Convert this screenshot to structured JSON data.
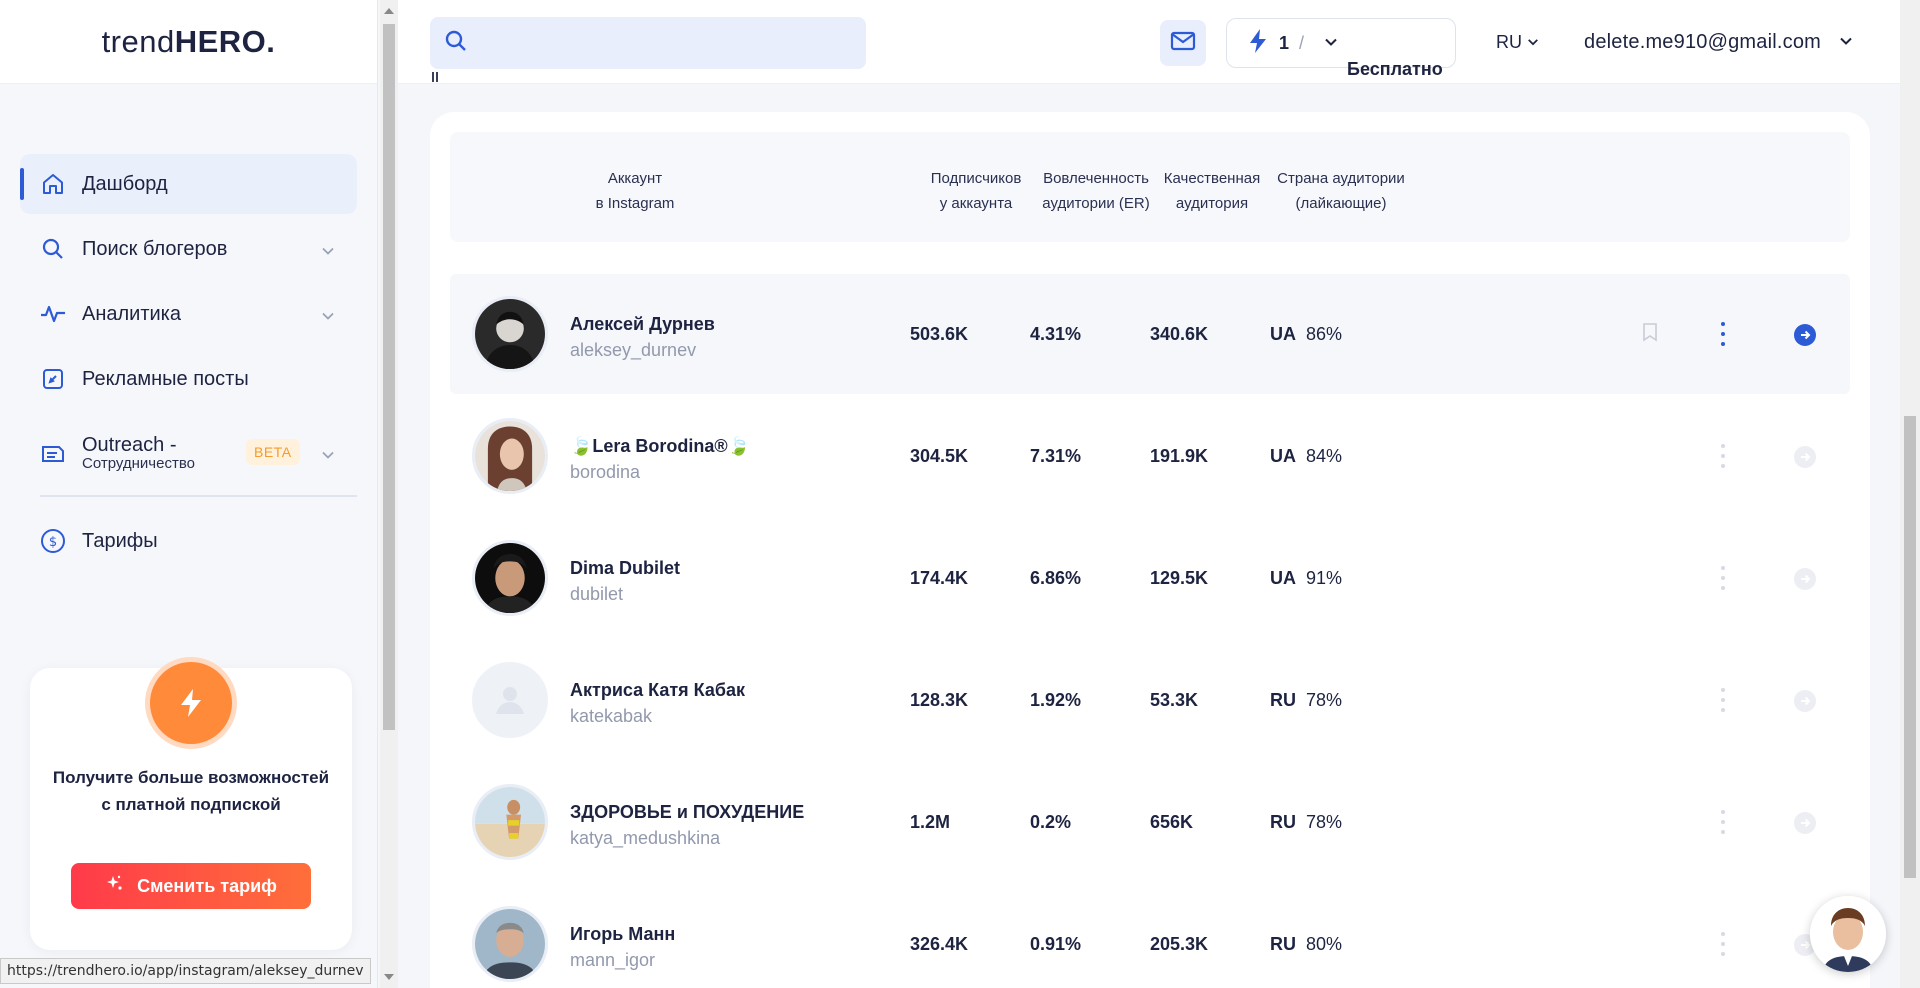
{
  "app": {
    "logo_light": "trend",
    "logo_bold": "HERO."
  },
  "sidebar": {
    "items": [
      {
        "label": "Дашборд"
      },
      {
        "label": "Поиск блогеров"
      },
      {
        "label": "Аналитика"
      },
      {
        "label": "Рекламные посты"
      },
      {
        "label": "Outreach -",
        "sublabel": "Сотрудничество",
        "badge": "BETA"
      },
      {
        "label": "Тарифы"
      }
    ],
    "promo": {
      "text": "Получите больше возможностей с платной подпиской",
      "button": "Сменить тариф"
    }
  },
  "status_url": "https://trendhero.io/app/instagram/aleksey_durnev",
  "header": {
    "search_placeholder": "",
    "plan_count": "1",
    "plan_sep": "/",
    "plan_name": "Бесплатно",
    "language": "RU",
    "user_email": "delete.me910@gmail.com"
  },
  "table": {
    "headers": {
      "account_1": "Аккаунт",
      "account_2": "в Instagram",
      "followers_1": "Подписчиков",
      "followers_2": "у аккаунта",
      "er_1": "Вовлеченность",
      "er_2": "аудитории (ER)",
      "quality_1": "Качественная",
      "quality_2": "аудитория",
      "country_1": "Страна аудитории",
      "country_2": "(лайкающие)"
    },
    "rows": [
      {
        "name": "Алексей Дурнев",
        "handle": "aleksey_durnev",
        "followers": "503.6K",
        "er": "4.31%",
        "quality": "340.6K",
        "country": "UA",
        "country_pct": "86%"
      },
      {
        "name": "🍃Lera Borodina®🍃",
        "handle": "borodina",
        "followers": "304.5K",
        "er": "7.31%",
        "quality": "191.9K",
        "country": "UA",
        "country_pct": "84%"
      },
      {
        "name": "Dima Dubilet",
        "handle": "dubilet",
        "followers": "174.4K",
        "er": "6.86%",
        "quality": "129.5K",
        "country": "UA",
        "country_pct": "91%"
      },
      {
        "name": "Актриса Катя Кабак",
        "handle": "katekabak",
        "followers": "128.3K",
        "er": "1.92%",
        "quality": "53.3K",
        "country": "RU",
        "country_pct": "78%"
      },
      {
        "name": "ЗДОРОВЬЕ и ПОХУДЕНИЕ",
        "handle": "katya_medushkina",
        "followers": "1.2M",
        "er": "0.2%",
        "quality": "656K",
        "country": "RU",
        "country_pct": "78%"
      },
      {
        "name": "Игорь Манн",
        "handle": "mann_igor",
        "followers": "326.4K",
        "er": "0.91%",
        "quality": "205.3K",
        "country": "RU",
        "country_pct": "80%"
      }
    ]
  },
  "colors": {
    "accent": "#2d5bd6",
    "promo_orange": "#ff8a3a",
    "button_red": "#ff3a4a"
  }
}
